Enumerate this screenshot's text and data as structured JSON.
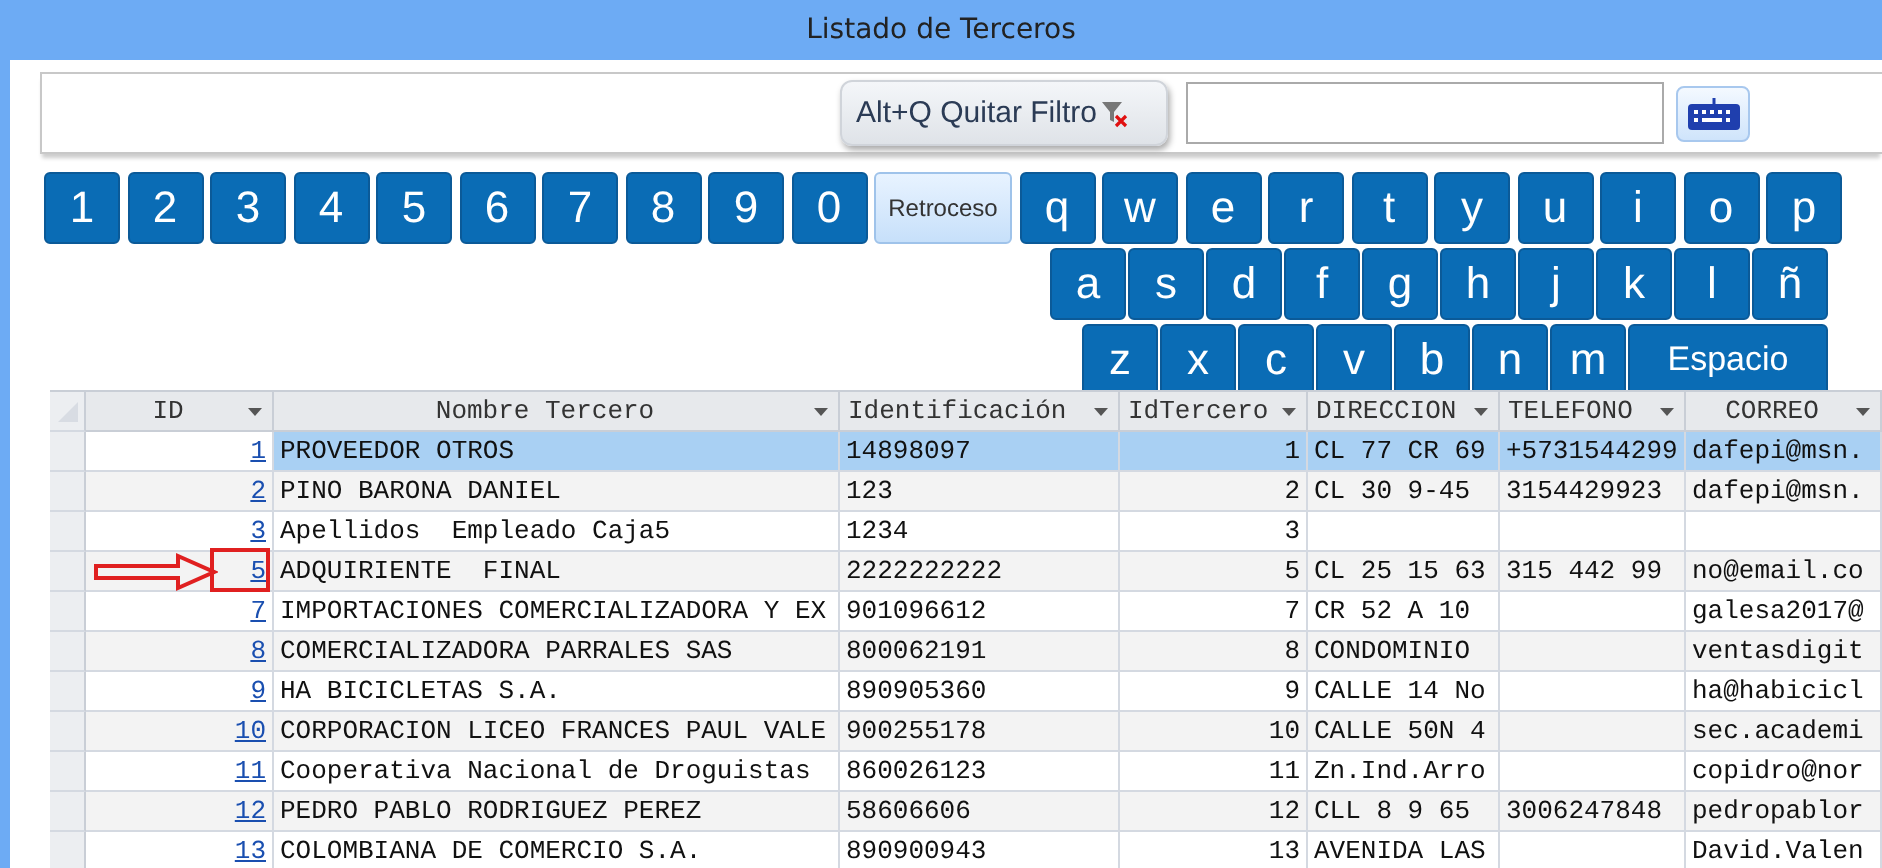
{
  "window": {
    "title": "Listado de Terceros"
  },
  "filter_button": "Alt+Q Quitar Filtro",
  "keyboard": {
    "rows": [
      {
        "keys": [
          {
            "label": "1",
            "kind": "char"
          },
          {
            "label": "2",
            "kind": "char"
          },
          {
            "label": "3",
            "kind": "char"
          },
          {
            "label": "4",
            "kind": "char"
          },
          {
            "label": "5",
            "kind": "char"
          },
          {
            "label": "6",
            "kind": "char"
          },
          {
            "label": "7",
            "kind": "char"
          },
          {
            "label": "8",
            "kind": "char"
          },
          {
            "label": "9",
            "kind": "char"
          },
          {
            "label": "0",
            "kind": "char"
          },
          {
            "label": "Retroceso",
            "kind": "backspace"
          },
          {
            "label": "q",
            "kind": "char"
          },
          {
            "label": "w",
            "kind": "char"
          },
          {
            "label": "e",
            "kind": "char"
          },
          {
            "label": "r",
            "kind": "char"
          },
          {
            "label": "t",
            "kind": "char"
          },
          {
            "label": "y",
            "kind": "char"
          },
          {
            "label": "u",
            "kind": "char"
          },
          {
            "label": "i",
            "kind": "char"
          },
          {
            "label": "o",
            "kind": "char"
          },
          {
            "label": "p",
            "kind": "char"
          }
        ]
      },
      {
        "keys": [
          {
            "label": "a",
            "kind": "char"
          },
          {
            "label": "s",
            "kind": "char"
          },
          {
            "label": "d",
            "kind": "char"
          },
          {
            "label": "f",
            "kind": "char"
          },
          {
            "label": "g",
            "kind": "char"
          },
          {
            "label": "h",
            "kind": "char"
          },
          {
            "label": "j",
            "kind": "char"
          },
          {
            "label": "k",
            "kind": "char"
          },
          {
            "label": "l",
            "kind": "char"
          },
          {
            "label": "ñ",
            "kind": "char"
          }
        ]
      },
      {
        "keys": [
          {
            "label": "z",
            "kind": "char"
          },
          {
            "label": "x",
            "kind": "char"
          },
          {
            "label": "c",
            "kind": "char"
          },
          {
            "label": "v",
            "kind": "char"
          },
          {
            "label": "b",
            "kind": "char"
          },
          {
            "label": "n",
            "kind": "char"
          },
          {
            "label": "m",
            "kind": "char"
          },
          {
            "label": "Espacio",
            "kind": "space"
          }
        ]
      }
    ]
  },
  "table": {
    "columns": [
      "ID",
      "Nombre Tercero",
      "Identificación",
      "IdTercero",
      "DIRECCION",
      "TELEFONO",
      "CORREO"
    ],
    "rows": [
      {
        "id": "1",
        "nombre": "PROVEEDOR OTROS",
        "identificacion": "14898097",
        "idtercero": "1",
        "direccion": "CL 77 CR 69",
        "telefono": "+5731544299",
        "correo": "dafepi@msn.",
        "selected": true,
        "marked": false
      },
      {
        "id": "2",
        "nombre": "PINO BARONA DANIEL",
        "identificacion": "123",
        "idtercero": "2",
        "direccion": "CL 30 9-45",
        "telefono": "3154429923",
        "correo": "dafepi@msn.",
        "selected": false,
        "marked": false
      },
      {
        "id": "3",
        "nombre": "Apellidos  Empleado Caja5",
        "identificacion": "1234",
        "idtercero": "3",
        "selected": false,
        "marked": false
      },
      {
        "id": "5",
        "nombre": "ADQUIRIENTE  FINAL",
        "identificacion": "2222222222",
        "idtercero": "5",
        "direccion": "CL 25 15 63",
        "telefono": "315 442 99",
        "correo": "no@email.co",
        "selected": false,
        "marked": true
      },
      {
        "id": "7",
        "nombre": "IMPORTACIONES COMERCIALIZADORA Y EX",
        "identificacion": "901096612",
        "idtercero": "7",
        "direccion": "CR 52 A 10",
        "correo": "galesa2017@",
        "selected": false,
        "marked": false
      },
      {
        "id": "8",
        "nombre": "COMERCIALIZADORA PARRALES SAS",
        "identificacion": "800062191",
        "idtercero": "8",
        "direccion": "CONDOMINIO",
        "correo": "ventasdigit",
        "selected": false,
        "marked": false
      },
      {
        "id": "9",
        "nombre": "HA BICICLETAS S.A.",
        "identificacion": "890905360",
        "idtercero": "9",
        "direccion": "CALLE 14 No",
        "correo": "ha@habicicl",
        "selected": false,
        "marked": false
      },
      {
        "id": "10",
        "nombre": "CORPORACION LICEO FRANCES PAUL VALE",
        "identificacion": "900255178",
        "idtercero": "10",
        "direccion": "CALLE 50N 4",
        "correo": "sec.academi",
        "selected": false,
        "marked": false
      },
      {
        "id": "11",
        "nombre": "Cooperativa Nacional de Droguistas",
        "identificacion": "860026123",
        "idtercero": "11",
        "direccion": "Zn.Ind.Arro",
        "correo": "copidro@nor",
        "selected": false,
        "marked": false
      },
      {
        "id": "12",
        "nombre": "PEDRO PABLO RODRIGUEZ PEREZ",
        "identificacion": "58606606",
        "idtercero": "12",
        "direccion": "CLL 8 9 65",
        "telefono": "3006247848",
        "correo": "pedropablor",
        "selected": false,
        "marked": false
      },
      {
        "id": "13",
        "nombre": "COLOMBIANA DE COMERCIO S.A.",
        "identificacion": "890900943",
        "idtercero": "13",
        "direccion": "AVENIDA LAS",
        "correo": "David.Valen",
        "selected": false,
        "marked": false
      }
    ]
  }
}
